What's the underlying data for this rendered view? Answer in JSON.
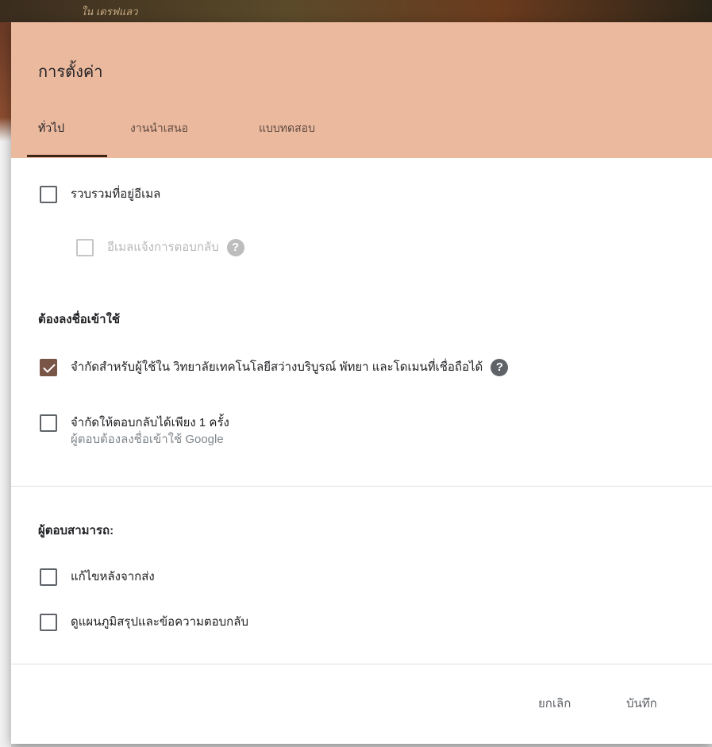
{
  "background": {
    "top_text": "ใน เดรฟแลว"
  },
  "dialog": {
    "title": "การตั้งค่า",
    "tabs": [
      {
        "label": "ทั่วไป",
        "active": true
      },
      {
        "label": "งานนำเสนอ",
        "active": false
      },
      {
        "label": "แบบทดสอบ",
        "active": false
      }
    ],
    "general": {
      "collect_email": {
        "label": "รวบรวมที่อยู่อีเมล",
        "checked": false
      },
      "email_receipt": {
        "label": "อีเมลแจ้งการตอบกลับ",
        "checked": false,
        "disabled": true
      },
      "requires_sign_in": {
        "title": "ต้องลงชื่อเข้าใช้",
        "restrict_domain": {
          "label": "จำกัดสำหรับผู้ใช้ใน วิทยาลัยเทคโนโลยีสว่างบริบูรณ์ พัทยา และโดเมนที่เชื่อถือได้",
          "checked": true
        },
        "limit_one": {
          "label": "จำกัดให้ตอบกลับได้เพียง 1 ครั้ง",
          "sublabel": "ผู้ตอบต้องลงชื่อเข้าใช้ Google",
          "checked": false
        }
      },
      "respondents_can": {
        "title": "ผู้ตอบสามารถ:",
        "edit_after_submit": {
          "label": "แก้ไขหลังจากส่ง",
          "checked": false
        },
        "see_summary": {
          "label": "ดูแผนภูมิสรุปและข้อความตอบกลับ",
          "checked": false
        }
      }
    },
    "help_icon_glyph": "?",
    "buttons": {
      "cancel": "ยกเลิก",
      "save": "บันทึก"
    },
    "colors": {
      "header": "#ebb99e",
      "accent": "#795548"
    }
  }
}
